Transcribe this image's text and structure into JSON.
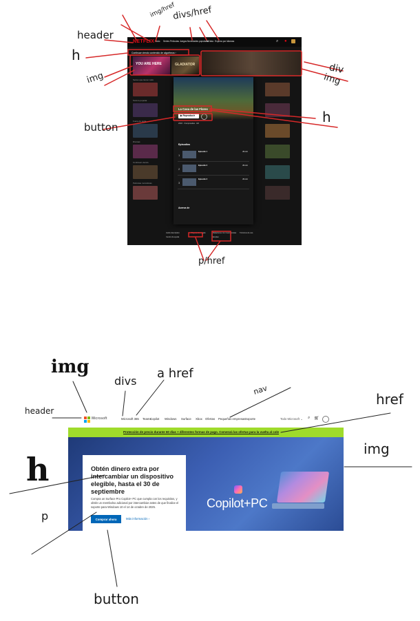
{
  "page": {
    "width": 610,
    "height": 902
  },
  "colors": {
    "ink": "#1a1a1a",
    "annot_red": "#d62828",
    "netflix_red": "#e50914",
    "ms_blue": "#0067b8",
    "ms_banner": "#9fdb2b"
  },
  "annotations_top": {
    "header": "header",
    "img_href": "img/href",
    "divs_href": "divs/href",
    "h_left": "h",
    "div_right": "div",
    "img_left": "img",
    "img_right": "img",
    "button": "button",
    "h_right": "h",
    "p_href": "p/href"
  },
  "annotations_bottom": {
    "img": "img",
    "divs": "divs",
    "a_href": "a href",
    "nav": "nav",
    "header": "header",
    "href": "href",
    "img_right": "img",
    "h": "h",
    "p": "p",
    "button": "button"
  },
  "netflix": {
    "logo": "NETFLIX",
    "nav": [
      "Inicio",
      "Series",
      "Películas",
      "Juegos",
      "Novedades populares",
      "Mi lista",
      "Explora por idiomas"
    ],
    "icons": [
      "search-icon",
      "bell-icon",
      "profile-icon"
    ],
    "hero_title": "Continuar viendo contenido de algoritmos ›",
    "tile1_title": "YOU ARE HERE",
    "tile2_title": "GLADIATOR",
    "rows": [
      "Series que tienen todo",
      "Todo lo popular",
      "Fuera de serie",
      "Dramas",
      "Continuar viendo",
      "Películas románticas"
    ],
    "modal": {
      "title": "La Casa de las Flores",
      "play_label": "▶ Reproducir",
      "meta": "2018 · 3 temporadas · HD",
      "episodes_label": "Episodios",
      "episodes": [
        {
          "num": "1",
          "title": "Episodio 1",
          "duration": "29 min"
        },
        {
          "num": "2",
          "title": "Episodio 2",
          "duration": "29 min"
        },
        {
          "num": "3",
          "title": "Episodio 3",
          "duration": "29 min"
        }
      ],
      "about": "Acerca de"
    },
    "footer_links": [
      "Audio descriptivo",
      "Centro de ayuda",
      "Tarjetas de regalo",
      "Relaciones con inversionistas",
      "Empleo",
      "Términos de uso"
    ]
  },
  "microsoft": {
    "logo_text": "Microsoft",
    "nav": [
      "Microsoft 365",
      "Teams",
      "Copilot",
      "Windows",
      "Surface",
      "Xbox",
      "Ofertas",
      "Pequeñas empresas",
      "Soporte"
    ],
    "right_nav": "Todo Microsoft ⌄",
    "banner": "Protección de precio durante 60 días + diferentes formas de pago. Comenzá las ofertas para la vuelta al cole",
    "hero_title": "Obtén dinero extra por intercambiar un dispositivo elegible, hasta el 30 de septiembre",
    "hero_text": "Compra un Surface Pro Copilot+ PC que cumpla con los requisitos, y obtén un reembolso adicional por intercambiar antes de que finalice el soporte para Windows 10 el 14 de octubre de 2025.",
    "buy_button": "Comprar ahora",
    "more_link": "Más información ›",
    "copilot_text": "Copilot+PC"
  }
}
